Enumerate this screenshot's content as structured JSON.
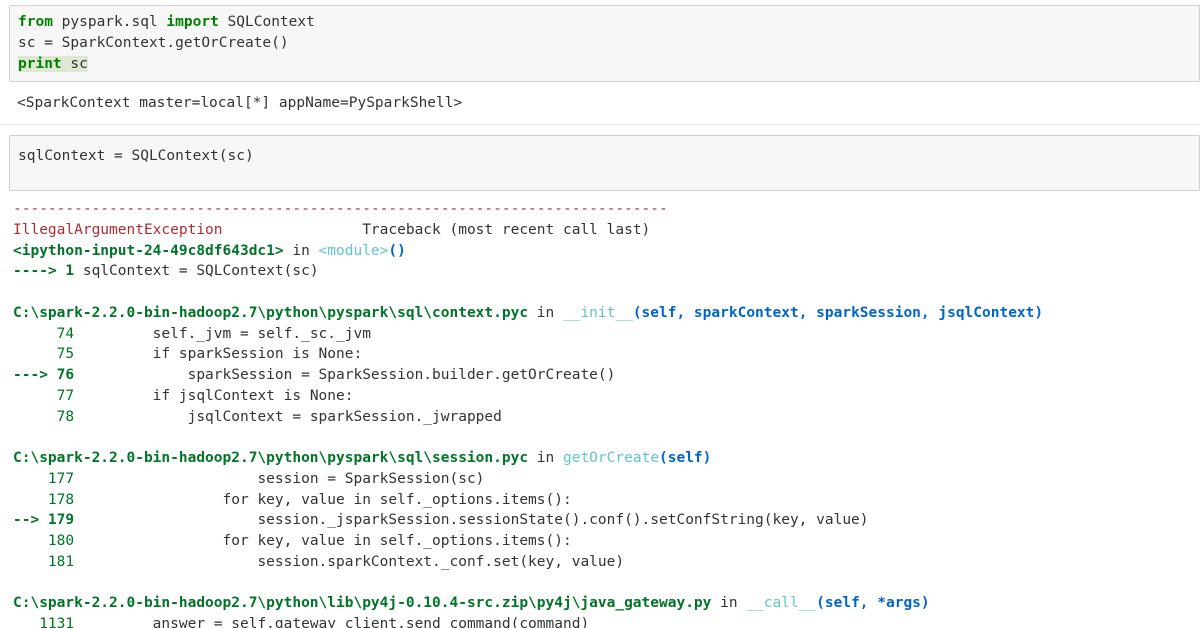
{
  "cell1": {
    "line1": {
      "kw_from": "from",
      "mid": " pyspark.sql ",
      "kw_import": "import",
      "rest": " SQLContext"
    },
    "line2": "sc = SparkContext.getOrCreate()",
    "line3": {
      "kw_print": "print",
      "rest": " sc"
    }
  },
  "output1": "<SparkContext master=local[*] appName=PySparkShell>",
  "cell2": {
    "line1": "sqlContext = SQLContext(sc)"
  },
  "traceback": {
    "dashes": "---------------------------------------------------------------------------",
    "exception_name": "IllegalArgumentException",
    "header_right": "                Traceback (most recent call last)",
    "input_ref": "<ipython-input-24-49c8df643dc1>",
    "in_word": " in ",
    "module_tag": "<module>",
    "module_parens": "()",
    "arrow_line_prefix": "----> 1 ",
    "arrow_line_code": "sqlContext = SQLContext(sc)",
    "frame1": {
      "path": "C:\\spark-2.2.0-bin-hadoop2.7\\python\\pyspark\\sql\\context.pyc",
      "in_word": " in ",
      "func": "__init__",
      "args": "(self, sparkContext, sparkSession, jsqlContext)",
      "lines": [
        {
          "num": "     74 ",
          "code": "        self._jvm = self._sc._jvm",
          "current": false
        },
        {
          "num": "     75 ",
          "code": "        if sparkSession is None:",
          "current": false
        },
        {
          "num": "---> 76 ",
          "code": "            sparkSession = SparkSession.builder.getOrCreate()",
          "current": true
        },
        {
          "num": "     77 ",
          "code": "        if jsqlContext is None:",
          "current": false
        },
        {
          "num": "     78 ",
          "code": "            jsqlContext = sparkSession._jwrapped",
          "current": false
        }
      ]
    },
    "frame2": {
      "path": "C:\\spark-2.2.0-bin-hadoop2.7\\python\\pyspark\\sql\\session.pyc",
      "in_word": " in ",
      "func": "getOrCreate",
      "args": "(self)",
      "lines": [
        {
          "num": "    177 ",
          "code": "                    session = SparkSession(sc)",
          "current": false
        },
        {
          "num": "    178 ",
          "code": "                for key, value in self._options.items():",
          "current": false
        },
        {
          "num": "--> 179 ",
          "code": "                    session._jsparkSession.sessionState().conf().setConfString(key, value)",
          "current": true
        },
        {
          "num": "    180 ",
          "code": "                for key, value in self._options.items():",
          "current": false
        },
        {
          "num": "    181 ",
          "code": "                    session.sparkContext._conf.set(key, value)",
          "current": false
        }
      ]
    },
    "frame3": {
      "path": "C:\\spark-2.2.0-bin-hadoop2.7\\python\\lib\\py4j-0.10.4-src.zip\\py4j\\java_gateway.py",
      "in_word": " in ",
      "func": "__call__",
      "args": "(self, *args)",
      "lines": [
        {
          "num": "   1131 ",
          "code": "        answer = self.gateway_client.send_command(command)",
          "current": false
        }
      ]
    }
  }
}
